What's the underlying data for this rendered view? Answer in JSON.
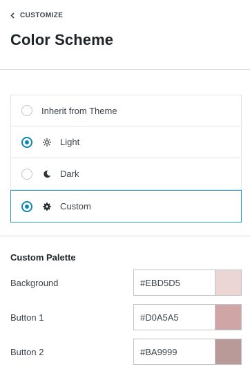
{
  "header": {
    "back_label": "CUSTOMIZE",
    "title": "Color Scheme"
  },
  "scheme_options": [
    {
      "label": "Inherit from Theme",
      "icon": "none",
      "selected": false
    },
    {
      "label": "Light",
      "icon": "sun-icon",
      "selected": true
    },
    {
      "label": "Dark",
      "icon": "moon-icon",
      "selected": false
    },
    {
      "label": "Custom",
      "icon": "gear-icon",
      "selected": true
    }
  ],
  "palette": {
    "title": "Custom Palette",
    "colors": [
      {
        "label": "Background",
        "value": "#EBD5D5",
        "swatch": "#EBD5D5"
      },
      {
        "label": "Button 1",
        "value": "#D0A5A5",
        "swatch": "#D0A5A5"
      },
      {
        "label": "Button 2",
        "value": "#BA9999",
        "swatch": "#BA9999"
      }
    ]
  },
  "colors": {
    "accent": "#0a87b2",
    "selected_border": "#2aa0c4"
  }
}
